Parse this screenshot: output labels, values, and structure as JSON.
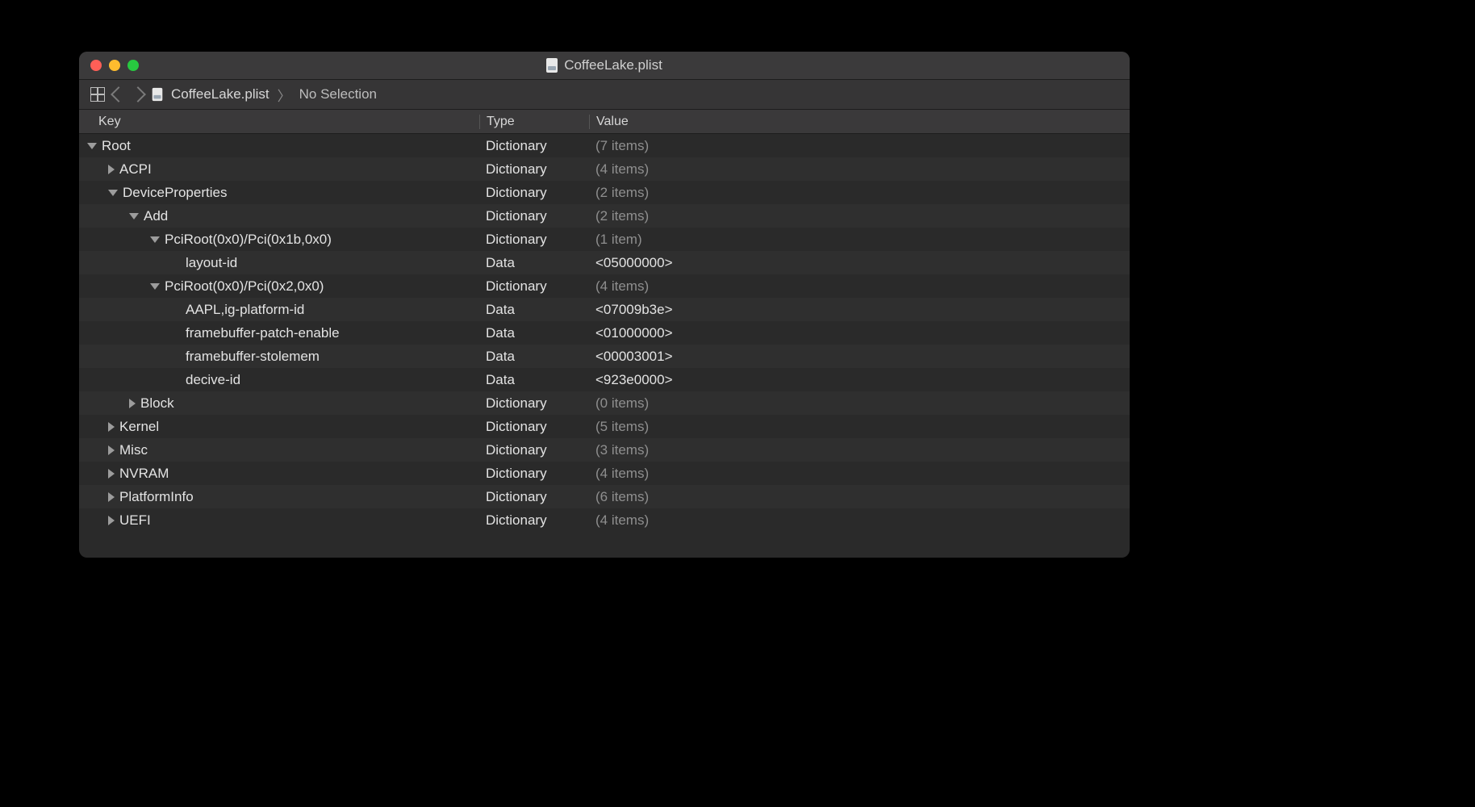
{
  "window": {
    "title": "CoffeeLake.plist"
  },
  "toolbar": {
    "breadcrumb_file": "CoffeeLake.plist",
    "breadcrumb_selection": "No Selection"
  },
  "columns": {
    "key": "Key",
    "type": "Type",
    "value": "Value"
  },
  "rows": [
    {
      "indent": 0,
      "arrow": "down",
      "key": "Root",
      "type": "Dictionary",
      "value": "(7 items)",
      "dim": true
    },
    {
      "indent": 1,
      "arrow": "right",
      "key": "ACPI",
      "type": "Dictionary",
      "value": "(4 items)",
      "dim": true
    },
    {
      "indent": 1,
      "arrow": "down",
      "key": "DeviceProperties",
      "type": "Dictionary",
      "value": "(2 items)",
      "dim": true
    },
    {
      "indent": 2,
      "arrow": "down",
      "key": "Add",
      "type": "Dictionary",
      "value": "(2 items)",
      "dim": true
    },
    {
      "indent": 3,
      "arrow": "down",
      "key": "PciRoot(0x0)/Pci(0x1b,0x0)",
      "type": "Dictionary",
      "value": "(1 item)",
      "dim": true
    },
    {
      "indent": 4,
      "arrow": "none",
      "key": "layout-id",
      "type": "Data",
      "value": "<05000000>",
      "dim": false
    },
    {
      "indent": 3,
      "arrow": "down",
      "key": "PciRoot(0x0)/Pci(0x2,0x0)",
      "type": "Dictionary",
      "value": "(4 items)",
      "dim": true
    },
    {
      "indent": 4,
      "arrow": "none",
      "key": "AAPL,ig-platform-id",
      "type": "Data",
      "value": "<07009b3e>",
      "dim": false
    },
    {
      "indent": 4,
      "arrow": "none",
      "key": "framebuffer-patch-enable",
      "type": "Data",
      "value": "<01000000>",
      "dim": false
    },
    {
      "indent": 4,
      "arrow": "none",
      "key": "framebuffer-stolemem",
      "type": "Data",
      "value": "<00003001>",
      "dim": false
    },
    {
      "indent": 4,
      "arrow": "none",
      "key": "decive-id",
      "type": "Data",
      "value": "<923e0000>",
      "dim": false
    },
    {
      "indent": 2,
      "arrow": "right",
      "key": "Block",
      "type": "Dictionary",
      "value": "(0 items)",
      "dim": true
    },
    {
      "indent": 1,
      "arrow": "right",
      "key": "Kernel",
      "type": "Dictionary",
      "value": "(5 items)",
      "dim": true
    },
    {
      "indent": 1,
      "arrow": "right",
      "key": "Misc",
      "type": "Dictionary",
      "value": "(3 items)",
      "dim": true
    },
    {
      "indent": 1,
      "arrow": "right",
      "key": "NVRAM",
      "type": "Dictionary",
      "value": "(4 items)",
      "dim": true
    },
    {
      "indent": 1,
      "arrow": "right",
      "key": "PlatformInfo",
      "type": "Dictionary",
      "value": "(6 items)",
      "dim": true
    },
    {
      "indent": 1,
      "arrow": "right",
      "key": "UEFI",
      "type": "Dictionary",
      "value": "(4 items)",
      "dim": true
    }
  ]
}
